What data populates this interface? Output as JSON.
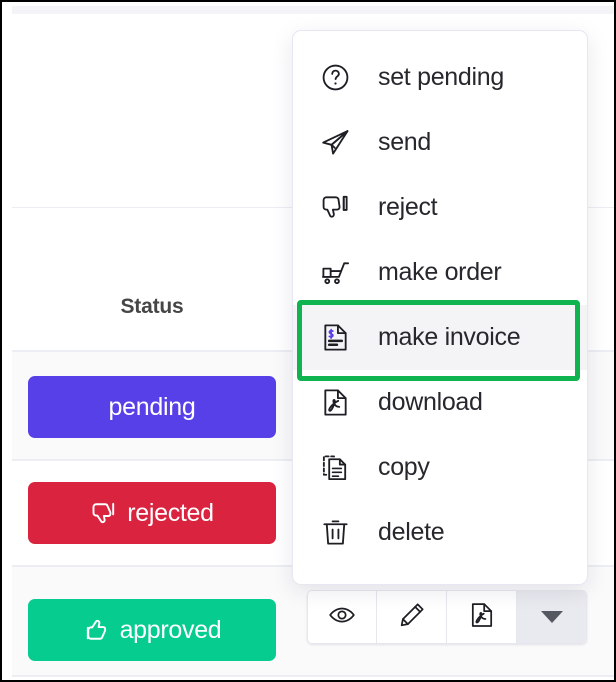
{
  "table": {
    "columns": [
      {
        "label": "Status",
        "name": "column-header-status"
      }
    ],
    "rows": [
      {
        "status_label": "pending",
        "status_color": "#5840e8",
        "icon": "none"
      },
      {
        "status_label": "rejected",
        "status_color": "#d9233f",
        "icon": "thumbs-down-icon"
      },
      {
        "status_label": "approved",
        "status_color": "#07cc90",
        "icon": "thumbs-up-icon"
      }
    ]
  },
  "toolbar": {
    "buttons": [
      {
        "label": "view",
        "icon": "eye-icon"
      },
      {
        "label": "edit",
        "icon": "pencil-icon"
      },
      {
        "label": "download",
        "icon": "pdf-file-icon"
      },
      {
        "label": "more",
        "icon": "caret-down-icon"
      }
    ]
  },
  "menu": {
    "items": [
      {
        "label": "set pending",
        "icon": "question-circle-icon",
        "highlighted": false
      },
      {
        "label": "send",
        "icon": "paper-plane-icon",
        "highlighted": false
      },
      {
        "label": "reject",
        "icon": "thumbs-down-icon",
        "highlighted": false
      },
      {
        "label": "make order",
        "icon": "shopping-cart-icon",
        "highlighted": false
      },
      {
        "label": "make invoice",
        "icon": "invoice-dollar-icon",
        "highlighted": true
      },
      {
        "label": "download",
        "icon": "pdf-file-icon",
        "highlighted": false
      },
      {
        "label": "copy",
        "icon": "copy-icon",
        "highlighted": false
      },
      {
        "label": "delete",
        "icon": "trash-icon",
        "highlighted": false
      }
    ]
  },
  "annotation": {
    "highlight_color": "#0fb450",
    "target_label": "make invoice"
  }
}
